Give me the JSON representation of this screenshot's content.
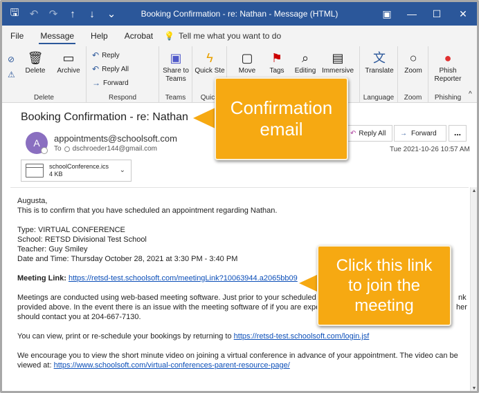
{
  "window": {
    "title": "Booking Confirmation - re: Nathan  -  Message (HTML)",
    "accent": "#2b579a"
  },
  "menu": {
    "tabs": [
      "File",
      "Message",
      "Help",
      "Acrobat"
    ],
    "active_tab": "Message",
    "tell_me": "Tell me what you want to do"
  },
  "ribbon": {
    "delete": {
      "delete_label": "Delete",
      "archive_label": "Archive",
      "group_label": "Delete"
    },
    "respond": {
      "reply_label": "Reply",
      "reply_all_label": "Reply All",
      "forward_label": "Forward",
      "group_label": "Respond"
    },
    "teams": {
      "share_label": "Share to Teams",
      "group_label": "Teams"
    },
    "quick": {
      "label": "Quick Ste",
      "group_label": "Quick"
    },
    "move": {
      "label": "Move"
    },
    "tags": {
      "label": "Tags"
    },
    "editing": {
      "label": "Editing"
    },
    "immersive": {
      "label": "Immersive"
    },
    "language": {
      "translate_label": "Translate",
      "group_label": "Language"
    },
    "zoom": {
      "label": "Zoom",
      "group_label": "Zoom"
    },
    "phishing": {
      "label": "Phish Reporter",
      "group_label": "Phishing"
    }
  },
  "message": {
    "subject": "Booking Confirmation - re: Nathan",
    "avatar_letter": "A",
    "avatar_color": "#8a6fc0",
    "sender": "appointments@schoolsoft.com",
    "to_label": "To",
    "to_address": "dschroeder144@gmail.com",
    "reply_all_label": "Reply All",
    "forward_label": "Forward",
    "more_label": "...",
    "date": "Tue 2021-10-26 10:57 AM",
    "attachment": {
      "name": "schoolConference.ics",
      "size": "4 KB"
    }
  },
  "body": {
    "greeting": "Augusta,",
    "intro": "This is to confirm that you have scheduled an appointment regarding Nathan.",
    "type": "Type: VIRTUAL CONFERENCE",
    "school": "School: RETSD Divisional Test School",
    "teacher": "Teacher: Guy Smiley",
    "datetime": "Date and Time: Thursday October 28, 2021 at 3:30 PM - 3:40 PM",
    "meeting_label": "Meeting Link:",
    "meeting_link": "https://retsd-test.schoolsoft.com/meetingLink?10063944.a2065bb09",
    "para1_a": "Meetings are conducted using web-based meeting software. Just prior to your scheduled m",
    "para1_b": "nk",
    "para1_c": "provided above. In the event there is an issue with the meeting software of if you are expect",
    "para1_d": "her",
    "para1_e": "should contact you at 204-667-7130.",
    "view_text": "You can view, print or re-schedule your bookings by returning to",
    "view_link": "https://retsd-test.schoolsoft.com/login.jsf",
    "video_text": "We encourage you to view the short minute video on joining a virtual conference in advance of your appointment. The video can be viewed at:",
    "video_link": "https://www.schoolsoft.com/virtual-conferences-parent-resource-page/"
  },
  "callouts": {
    "confirmation": "Confirmation\nemail",
    "link": "Click this link\nto join the\nmeeting",
    "color": "#f6a912"
  }
}
